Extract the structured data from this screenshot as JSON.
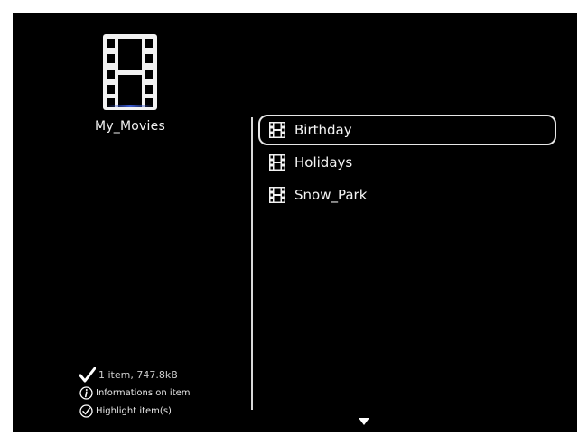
{
  "folder": {
    "name": "My_Movies",
    "icon": "film-strip-icon",
    "accent_color": "#3a5ad0"
  },
  "files": [
    {
      "name": "Birthday",
      "icon": "film-strip-icon",
      "selected": true
    },
    {
      "name": "Holidays",
      "icon": "film-strip-icon",
      "selected": false
    },
    {
      "name": "Snow_Park",
      "icon": "film-strip-icon",
      "selected": false
    }
  ],
  "status": {
    "item_info": "1 item, 747.8kB",
    "info_hint": "Informations on item",
    "highlight_hint": "Highlight item(s)"
  },
  "navigation": {
    "more_below_icon": "down-arrow-icon"
  },
  "colors": {
    "background": "#000000",
    "text": "#f2f2f2",
    "selection_border": "#e6e6e6"
  }
}
